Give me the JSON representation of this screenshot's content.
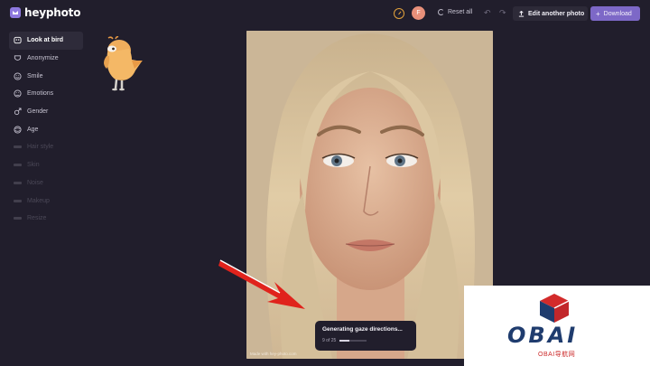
{
  "header": {
    "logo_text": "heyphoto",
    "avatar_initial": "F",
    "reset_label": "Reset all",
    "edit_label": "Edit another photo",
    "download_label": "Download"
  },
  "sidebar": {
    "items": [
      {
        "label": "Look at bird",
        "icon": "look-icon",
        "state": "active"
      },
      {
        "label": "Anonymize",
        "icon": "mask-icon",
        "state": "enabled"
      },
      {
        "label": "Smile",
        "icon": "smile-icon",
        "state": "enabled"
      },
      {
        "label": "Emotions",
        "icon": "emotion-icon",
        "state": "enabled"
      },
      {
        "label": "Gender",
        "icon": "gender-icon",
        "state": "enabled"
      },
      {
        "label": "Age",
        "icon": "age-icon",
        "state": "enabled"
      },
      {
        "label": "Hair style",
        "icon": "placeholder-icon",
        "state": "disabled"
      },
      {
        "label": "Skin",
        "icon": "placeholder-icon",
        "state": "disabled"
      },
      {
        "label": "Noise",
        "icon": "placeholder-icon",
        "state": "disabled"
      },
      {
        "label": "Makeup",
        "icon": "placeholder-icon",
        "state": "disabled"
      },
      {
        "label": "Resize",
        "icon": "placeholder-icon",
        "state": "disabled"
      }
    ]
  },
  "photo": {
    "watermark": "Made with hey-photo.com"
  },
  "toast": {
    "title": "Generating gaze directions...",
    "count": "9 of 25",
    "progress": 0.36
  },
  "brand": {
    "name": "OBAI",
    "subtitle": "OBAI导航网"
  },
  "colors": {
    "background": "#211e2c",
    "accent": "#7d68c7",
    "arrow": "#e0231c"
  }
}
